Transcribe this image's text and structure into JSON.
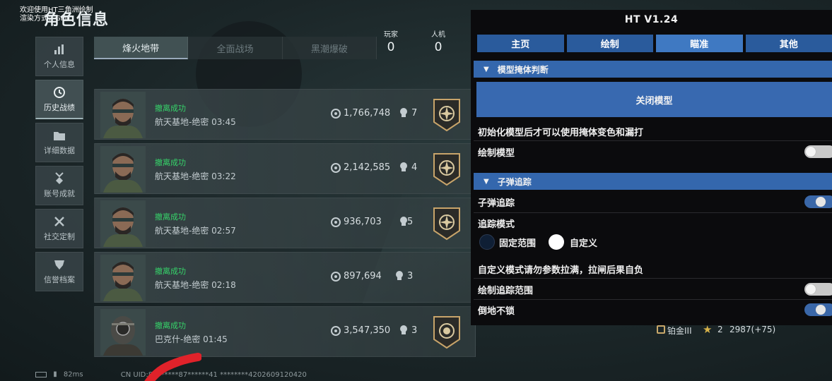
{
  "overlay": {
    "line1": "欢迎使用HT三角洲绘制",
    "line2": "渲染方式：GPU"
  },
  "page_title": "角色信息",
  "sidebar": {
    "items": [
      {
        "label": "个人信息",
        "icon": "bar-chart-icon",
        "active": false
      },
      {
        "label": "历史战绩",
        "icon": "clock-icon",
        "active": true
      },
      {
        "label": "详细数据",
        "icon": "folder-icon",
        "active": false
      },
      {
        "label": "账号成就",
        "icon": "medal-icon",
        "active": false
      },
      {
        "label": "社交定制",
        "icon": "tools-icon",
        "active": false
      },
      {
        "label": "信誉档案",
        "icon": "shield-icon",
        "active": false
      }
    ]
  },
  "mode_tabs": [
    {
      "label": "烽火地带",
      "active": true
    },
    {
      "label": "全面战场",
      "active": false
    },
    {
      "label": "黑潮爆破",
      "active": false
    }
  ],
  "counters": {
    "players_label": "玩家",
    "players_value": "0",
    "ai_label": "人机",
    "ai_value": "0"
  },
  "matches": [
    {
      "result": "撤离成功",
      "map_time": "航天基地-绝密 03:45",
      "money": "1,766,748",
      "kills": "7"
    },
    {
      "result": "撤离成功",
      "map_time": "航天基地-绝密 03:22",
      "money": "2,142,585",
      "kills": "4"
    },
    {
      "result": "撤离成功",
      "map_time": "航天基地-绝密 02:57",
      "money": "936,703",
      "kills": "5"
    },
    {
      "result": "撤离成功",
      "map_time": "航天基地-绝密 02:18",
      "money": "897,694",
      "kills": "3"
    },
    {
      "result": "撤离成功",
      "map_time": "巴克什-绝密 01:45",
      "money": "3,547,350",
      "kills": "3"
    }
  ],
  "rank_row": {
    "rank": "铂金III",
    "stars": "2",
    "score": "2987(+75)"
  },
  "bottom_bar": {
    "ping": "82ms",
    "uid": "CN UID:80******87******41   ********4202609120420"
  },
  "ht_menu": {
    "title": "HT  V1.24",
    "tabs": [
      "主页",
      "绘制",
      "瞄准",
      "其他"
    ],
    "active_tab": "瞄准",
    "section1": "模型掩体判断",
    "close_model_button": "关闭模型",
    "init_note": "初始化模型后才可以使用掩体变色和漏打",
    "draw_model_label": "绘制模型",
    "draw_model_on": false,
    "section2": "子弹追踪",
    "bullet_track_label": "子弹追踪",
    "bullet_track_on": true,
    "track_mode_label": "追踪模式",
    "mode_fixed": "固定范围",
    "mode_custom": "自定义",
    "custom_warning": "自定义模式请勿参数拉满，拉闸后果自负",
    "draw_range_label": "绘制追踪范围",
    "draw_range_on": false,
    "no_lock_down_label": "倒地不锁",
    "no_lock_down_on": true,
    "accent": "#3467ad"
  }
}
